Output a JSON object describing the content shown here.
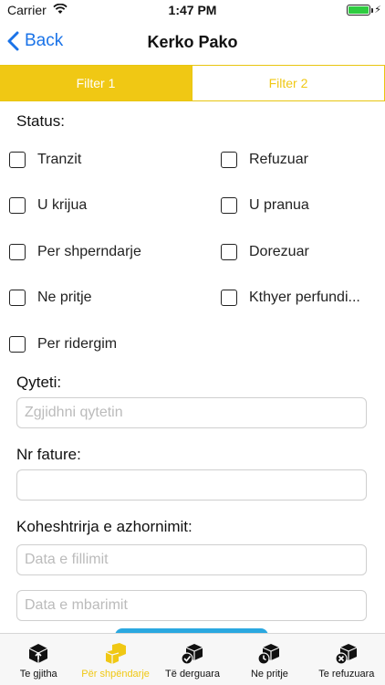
{
  "status_bar": {
    "carrier": "Carrier",
    "time": "1:47 PM"
  },
  "nav": {
    "back_label": "Back",
    "title": "Kerko Pako"
  },
  "tabs": [
    {
      "label": "Filter 1",
      "active": true
    },
    {
      "label": "Filter 2",
      "active": false
    }
  ],
  "form": {
    "status_label": "Status:",
    "statuses": [
      {
        "label": "Tranzit",
        "checked": false
      },
      {
        "label": "Refuzuar",
        "checked": false
      },
      {
        "label": "U krijua",
        "checked": false
      },
      {
        "label": "U pranua",
        "checked": false
      },
      {
        "label": "Per shperndarje",
        "checked": false
      },
      {
        "label": "Dorezuar",
        "checked": false
      },
      {
        "label": "Ne pritje",
        "checked": false
      },
      {
        "label": "Kthyer perfundi...",
        "checked": false
      },
      {
        "label": "Per ridergim",
        "checked": false
      }
    ],
    "city_label": "Qyteti:",
    "city_placeholder": "Zgjidhni qytetin",
    "city_value": "",
    "invoice_label": "Nr fature:",
    "invoice_placeholder": "",
    "invoice_value": "",
    "update_time_label": "Koheshtrirja e azhornimit:",
    "start_date_placeholder": "Data e fillimit",
    "end_date_placeholder": "Data e mbarimit"
  },
  "tab_bar": [
    {
      "label": "Te gjitha",
      "icon": "package-icon",
      "active": false
    },
    {
      "label": "Për shpëndarje",
      "icon": "packages-icon",
      "active": true
    },
    {
      "label": "Të derguara",
      "icon": "package-delivered-icon",
      "active": false
    },
    {
      "label": "Ne pritje",
      "icon": "package-pending-icon",
      "active": false
    },
    {
      "label": "Te refuzuara",
      "icon": "package-rejected-icon",
      "active": false
    }
  ],
  "colors": {
    "accent": "#f0c814",
    "link": "#1a73e8",
    "button": "#2aa8e0"
  }
}
